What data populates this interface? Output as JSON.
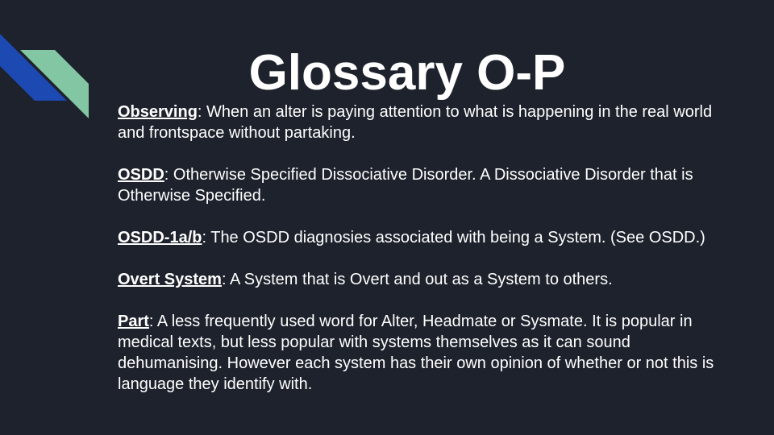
{
  "slide": {
    "title": "Glossary O-P",
    "accent_colors": {
      "blue": "#1d49b3",
      "green": "#83c6a3",
      "background": "#1d222c"
    }
  },
  "entries": [
    {
      "term": "Observing",
      "definition": ": When an alter is paying attention to what is happening in the real world and frontspace without partaking."
    },
    {
      "term": "OSDD",
      "definition": ": Otherwise Specified Dissociative Disorder. A Dissociative Disorder that is Otherwise Specified."
    },
    {
      "term": "OSDD-1a/b",
      "definition": ": The OSDD diagnosies associated with being a System. (See OSDD.)"
    },
    {
      "term": "Overt System",
      "definition": ": A System that is Overt and out as a System to others."
    },
    {
      "term": "Part",
      "definition": ": A less frequently used word for Alter, Headmate or Sysmate. It is popular in medical texts, but less popular with systems themselves as it can sound dehumanising. However each system has their own opinion of whether or not this is language they identify with."
    }
  ]
}
